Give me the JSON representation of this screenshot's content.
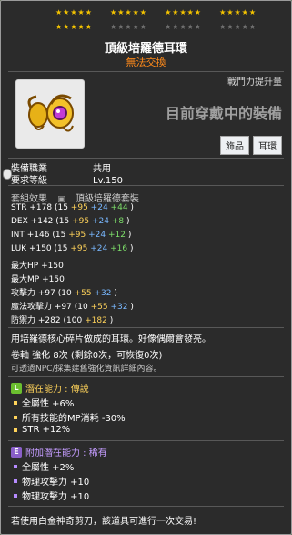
{
  "item": {
    "title": "頂級培羅德耳環",
    "tradeability": "無法交換",
    "combat_power_label": "戰鬥力提升量",
    "equipped_label": "目前穿戴中的裝備",
    "tags": [
      "飾品",
      "耳環"
    ]
  },
  "stars": {
    "row1_filled": 20,
    "row2_filled": 5,
    "row2_empty": 15
  },
  "requirements": {
    "job_label": "裝備職業",
    "job_value": "共用",
    "level_label": "要求等級",
    "level_value": "Lv.150"
  },
  "set_effect": {
    "label": "套組效果",
    "value": "頂級培羅德套裝"
  },
  "stats": [
    {
      "name": "STR",
      "total": "+178",
      "open": "(15",
      "y": "+95",
      "b": "+24",
      "g": "+44",
      "close": ")"
    },
    {
      "name": "DEX",
      "total": "+142",
      "open": "(15",
      "y": "+95",
      "b": "+24",
      "g": "+8",
      "close": ")"
    },
    {
      "name": "INT",
      "total": "+146",
      "open": "(15",
      "y": "+95",
      "b": "+24",
      "g": "+12",
      "close": ")"
    },
    {
      "name": "LUK",
      "total": "+150",
      "open": "(15",
      "y": "+95",
      "b": "+24",
      "g": "+16",
      "close": ")"
    },
    {
      "name": "最大HP",
      "total": "+150"
    },
    {
      "name": "最大MP",
      "total": "+150"
    },
    {
      "name": "攻擊力",
      "total": "+97",
      "open": "(10",
      "y": "+55",
      "b": "+32",
      "close": ")"
    },
    {
      "name": "魔法攻擊力",
      "total": "+97",
      "open": "(10",
      "y": "+55",
      "b": "+32",
      "close": ")"
    },
    {
      "name": "防禦力",
      "total": "+282",
      "open": "(100",
      "y": "+182",
      "close": ")"
    }
  ],
  "description": "用培羅德核心碎片做成的耳環。好像偶爾會發亮。",
  "scroll": "卷軸 強化 8次 (剩餘0次，可恢復0次)",
  "enhance_note": "可透過NPC/採集建舊強化資訊詳細內容。",
  "potential": {
    "label": "潛在能力 : 傳說",
    "lines": [
      "全屬性 +6%",
      "所有技能的MP消耗 -30%",
      "STR +12%"
    ]
  },
  "additional": {
    "label": "附加潛在能力 : 稀有",
    "lines": [
      "全屬性 +2%",
      "物理攻擊力 +10",
      "物理攻擊力 +10"
    ]
  },
  "trade_note": "若使用白金神奇剪刀，該道具可進行一次交易!"
}
